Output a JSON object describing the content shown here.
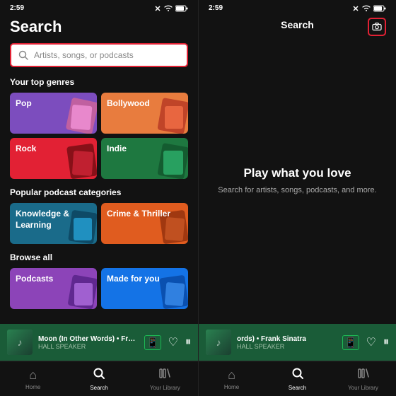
{
  "left": {
    "statusBar": {
      "time": "2:59",
      "icons": [
        "signal",
        "wifi",
        "battery"
      ]
    },
    "pageTitle": "Search",
    "searchBar": {
      "placeholder": "Artists, songs, or podcasts"
    },
    "topGenresLabel": "Your top genres",
    "genres": [
      {
        "id": "pop",
        "label": "Pop",
        "colorClass": "card-pop"
      },
      {
        "id": "bollywood",
        "label": "Bollywood",
        "colorClass": "card-bollywood"
      },
      {
        "id": "rock",
        "label": "Rock",
        "colorClass": "card-rock"
      },
      {
        "id": "indie",
        "label": "Indie",
        "colorClass": "card-indie"
      }
    ],
    "podcastCategoriesLabel": "Popular podcast categories",
    "podcastCategories": [
      {
        "id": "knowledge",
        "label": "Knowledge & Learning",
        "colorClass": "card-knowledge"
      },
      {
        "id": "crime",
        "label": "Crime & Thriller",
        "colorClass": "card-crime"
      }
    ],
    "browseAllLabel": "Browse all",
    "browseAll": [
      {
        "id": "podcasts",
        "label": "Podcasts",
        "colorClass": "card-podcasts"
      },
      {
        "id": "madeforyou",
        "label": "Made for you",
        "colorClass": "card-madeforyou"
      }
    ],
    "nowPlaying": {
      "title": "Moon (In Other Words) • Frank",
      "artist": "HALL SPEAKER",
      "bgColor": "#1a5c38"
    },
    "bottomNav": [
      {
        "id": "home",
        "label": "Home",
        "icon": "⌂",
        "active": false
      },
      {
        "id": "search",
        "label": "Search",
        "icon": "◎",
        "active": true
      },
      {
        "id": "library",
        "label": "Your Library",
        "icon": "▤",
        "active": false
      }
    ]
  },
  "right": {
    "statusBar": {
      "time": "2:59",
      "icons": [
        "signal",
        "wifi",
        "battery"
      ]
    },
    "title": "Search",
    "cameraButton": "camera-icon",
    "mainMessage": "Play what you love",
    "subMessage": "Search for artists, songs, podcasts, and more.",
    "nowPlaying": {
      "title": "ords) • Frank Sinatra",
      "artist": "HALL SPEAKER",
      "bgColor": "#1a5c38"
    },
    "bottomNav": [
      {
        "id": "home",
        "label": "Home",
        "icon": "⌂",
        "active": false
      },
      {
        "id": "search",
        "label": "Search",
        "icon": "◎",
        "active": true
      },
      {
        "id": "library",
        "label": "Your Library",
        "icon": "▤",
        "active": false
      }
    ]
  }
}
